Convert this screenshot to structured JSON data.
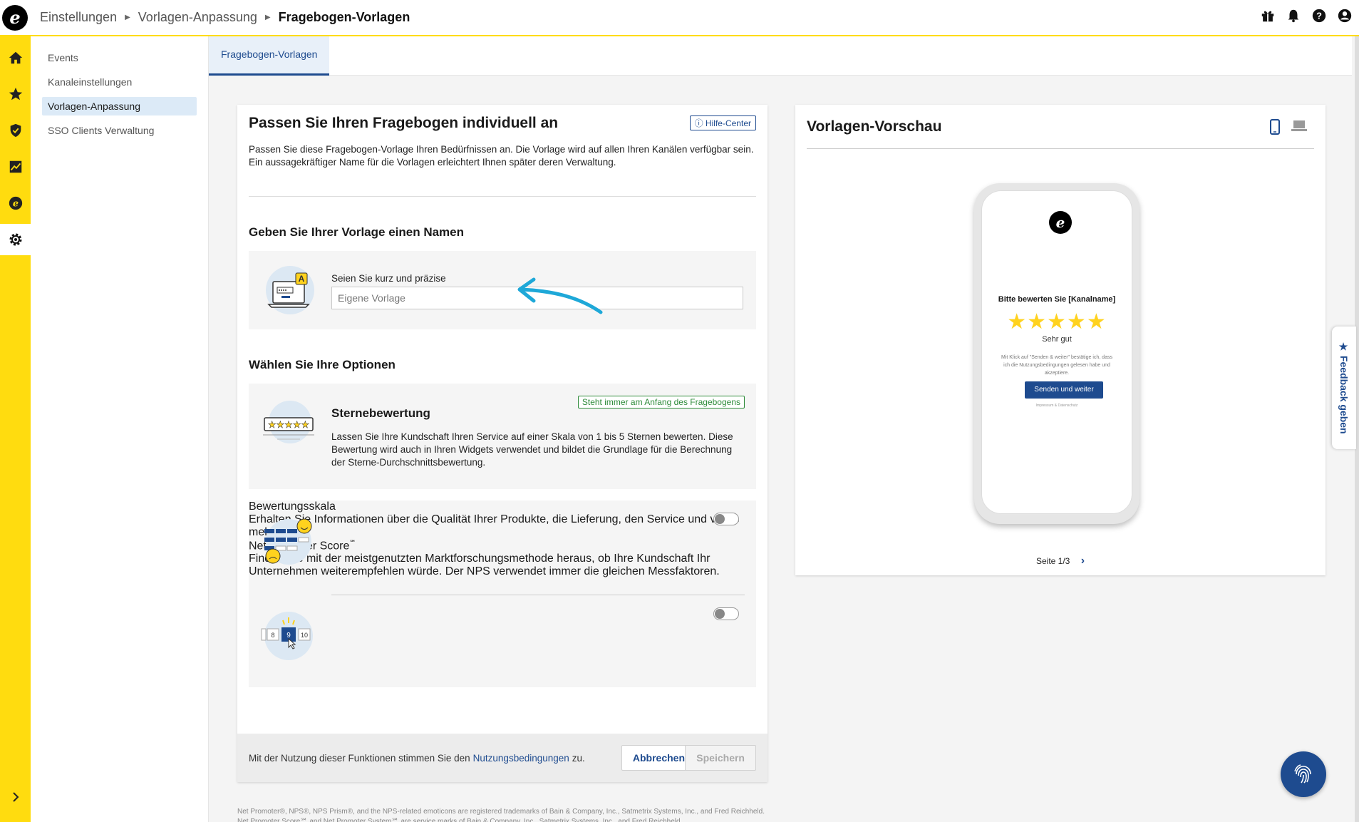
{
  "breadcrumb": {
    "items": [
      "Einstellungen",
      "Vorlagen-Anpassung"
    ],
    "current": "Fragebogen-Vorlagen"
  },
  "icons": {
    "top": [
      "gift-icon",
      "bell-icon",
      "help-icon",
      "user-icon"
    ],
    "rail": [
      "home-icon",
      "star-icon",
      "shield-icon",
      "chart-icon",
      "e-logo-icon",
      "gear-icon"
    ]
  },
  "subnav": {
    "items": [
      "Events",
      "Kanaleinstellungen",
      "Vorlagen-Anpassung",
      "SSO Clients Verwaltung"
    ],
    "active_index": 2
  },
  "tabs": {
    "active": "Fragebogen-Vorlagen"
  },
  "editor": {
    "title": "Passen Sie Ihren Fragebogen individuell an",
    "help_label": "Hilfe-Center",
    "description": "Passen Sie diese Fragebogen-Vorlage Ihren Bedürfnissen an. Die Vorlage wird auf allen Ihren Kanälen verfügbar sein. Ein aussagekräftiger Name für die Vorlagen erleichtert Ihnen später deren Verwaltung.",
    "name_section": {
      "heading": "Geben Sie Ihrer Vorlage einen Namen",
      "field_label": "Seien Sie kurz und präzise",
      "placeholder": "Eigene Vorlage"
    },
    "options_heading": "Wählen Sie Ihre Optionen",
    "options": {
      "stars": {
        "title": "Sternebewertung",
        "badge": "Steht immer am Anfang des Fragebogens",
        "text": "Lassen Sie Ihre Kundschaft Ihren Service auf einer Skala von 1 bis 5 Sternen bewerten. Diese Bewertung wird auch in Ihren Widgets verwendet und bildet die Grundlage für die Berechnung der Sterne-Durchschnittsbewertung."
      },
      "scale": {
        "title": "Bewertungsskala",
        "text": "Erhalten Sie Informationen über die Qualität Ihrer Produkte, die Lieferung, den Service und vieles mehr.",
        "enabled": false
      },
      "nps": {
        "title": "Net Promoter Score",
        "title_sup": "℠",
        "text": "Finden Sie mit der meistgenutzten Marktforschungsmethode heraus, ob Ihre Kundschaft Ihr Unternehmen weiterempfehlen würde. Der NPS verwendet immer die gleichen Messfaktoren.",
        "enabled": false,
        "illustration_numbers": [
          "8",
          "9",
          "10"
        ]
      }
    },
    "footer": {
      "text_before": "Mit der Nutzung dieser Funktionen stimmen Sie den",
      "link": "Nutzungsbedingungen",
      "text_after": "zu.",
      "cancel": "Abbrechen",
      "save": "Speichern"
    }
  },
  "legal": "Net Promoter®, NPS®, NPS Prism®, and the NPS-related emoticons are registered trademarks of Bain & Company, Inc., Satmetrix Systems, Inc., and Fred Reichheld. Net Promoter Score℠ and Net Promoter System℠ are service marks of Bain & Company, Inc., Satmetrix Systems, Inc., and Fred Reichheld.",
  "preview": {
    "title": "Vorlagen-Vorschau",
    "phone": {
      "title": "Bitte bewerten Sie [Kanalname]",
      "stars": "★★★★★",
      "rating_label": "Sehr gut",
      "consent": "Mit Klick auf \"Senden & weiter\" bestätige ich, dass ich die Nutzungsbedingungen gelesen habe und akzeptiere.",
      "button": "Senden und weiter",
      "footer": "Impressum & Datenschutz"
    },
    "pager": "Seite 1/3"
  },
  "feedback_tab": "★ Feedback geben",
  "colors": {
    "accent_yellow": "#ffdc0f",
    "primary_blue": "#1e4b8f",
    "star": "#ffd21e",
    "success": "#2e8b3a"
  }
}
